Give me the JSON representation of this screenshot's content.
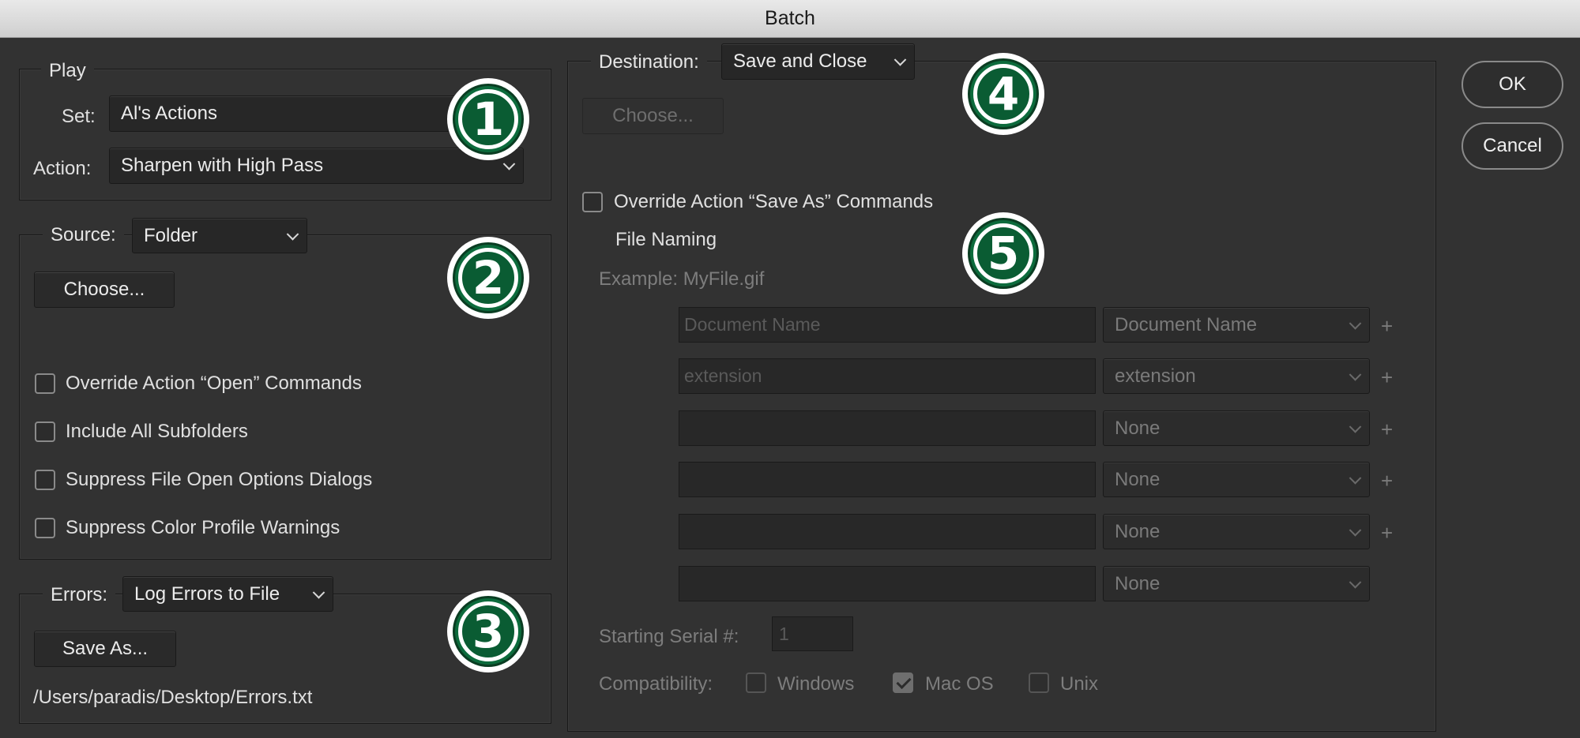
{
  "window": {
    "title": "Batch"
  },
  "play": {
    "legend": "Play",
    "set_label": "Set:",
    "set_value": "Al's Actions",
    "action_label": "Action:",
    "action_value": "Sharpen with High Pass"
  },
  "source": {
    "label": "Source:",
    "value": "Folder",
    "choose_label": "Choose...",
    "checkboxes": [
      {
        "label": "Override Action “Open” Commands",
        "checked": false
      },
      {
        "label": "Include All Subfolders",
        "checked": false
      },
      {
        "label": "Suppress File Open Options Dialogs",
        "checked": false
      },
      {
        "label": "Suppress Color Profile Warnings",
        "checked": false
      }
    ]
  },
  "errors": {
    "label": "Errors:",
    "value": "Log Errors to File",
    "save_as_label": "Save As...",
    "path": "/Users/paradis/Desktop/Errors.txt"
  },
  "destination": {
    "label": "Destination:",
    "value": "Save and Close",
    "choose_label": "Choose...",
    "override_label": "Override Action “Save As” Commands",
    "file_naming_label": "File Naming",
    "example": "Example: MyFile.gif",
    "rows": [
      {
        "text": "Document Name",
        "select": "Document Name",
        "plus": "+"
      },
      {
        "text": "extension",
        "select": "extension",
        "plus": "+"
      },
      {
        "text": "",
        "select": "None",
        "plus": "+"
      },
      {
        "text": "",
        "select": "None",
        "plus": "+"
      },
      {
        "text": "",
        "select": "None",
        "plus": "+"
      },
      {
        "text": "",
        "select": "None",
        "plus": ""
      }
    ],
    "serial_label": "Starting Serial #:",
    "serial_value": "1",
    "compat_label": "Compatibility:",
    "compat": [
      {
        "label": "Windows",
        "checked": false
      },
      {
        "label": "Mac OS",
        "checked": true
      },
      {
        "label": "Unix",
        "checked": false
      }
    ]
  },
  "buttons": {
    "ok": "OK",
    "cancel": "Cancel"
  },
  "badges": [
    "1",
    "2",
    "3",
    "4",
    "5"
  ],
  "colors": {
    "badge_green": "#0c6b3c",
    "background": "#323232"
  }
}
